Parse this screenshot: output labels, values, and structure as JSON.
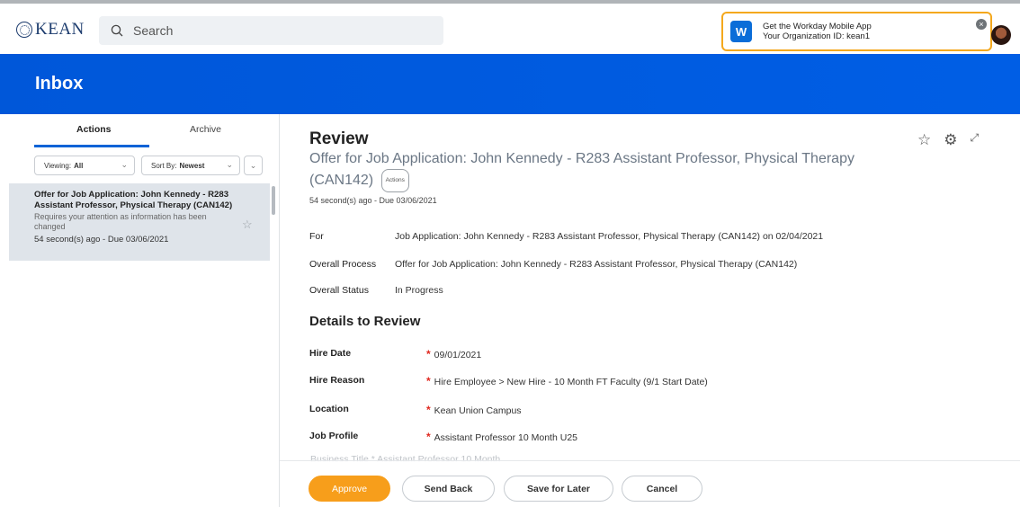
{
  "header": {
    "logo_text": "KEAN",
    "search_placeholder": "Search",
    "promo": {
      "logo_letter": "W",
      "title": "Get the Workday Mobile App",
      "subtitle": "Your Organization ID: kean1"
    }
  },
  "inbox": {
    "title": "Inbox",
    "tabs": [
      {
        "label": "Actions",
        "active": true
      },
      {
        "label": "Archive",
        "active": false
      }
    ],
    "filters": {
      "viewing_label": "Viewing:",
      "viewing_value": "All",
      "sort_label": "Sort By:",
      "sort_value": "Newest"
    },
    "items": [
      {
        "title": "Offer for Job Application: John Kennedy - R283 Assistant Professor, Physical Therapy (CAN142)",
        "description": "Requires your attention as information has been changed",
        "due": "54 second(s) ago - Due 03/06/2021"
      }
    ]
  },
  "review": {
    "title": "Review",
    "subtitle": "Offer for Job Application: John Kennedy - R283 Assistant Professor, Physical Therapy (CAN142)",
    "actions_pill": "Actions",
    "timestamp": "54 second(s) ago - Due 03/06/2021",
    "fields": [
      {
        "label": "For",
        "value": "Job Application: John Kennedy - R283 Assistant Professor, Physical Therapy (CAN142) on 02/04/2021"
      },
      {
        "label": "Overall Process",
        "value": "Offer for Job Application: John Kennedy - R283 Assistant Professor, Physical Therapy (CAN142)"
      },
      {
        "label": "Overall Status",
        "value": "In Progress"
      }
    ],
    "details_title": "Details to Review",
    "details": [
      {
        "label": "Hire Date",
        "value": "09/01/2021"
      },
      {
        "label": "Hire Reason",
        "value": "Hire Employee > New Hire - 10 Month FT Faculty (9/1 Start Date)"
      },
      {
        "label": "Location",
        "value": "Kean Union Campus"
      },
      {
        "label": "Job Profile",
        "value": "Assistant Professor 10 Month U25"
      }
    ],
    "partial_row": "Business Title    *  Assistant Professor 10 Month"
  },
  "buttons": {
    "approve": "Approve",
    "send_back": "Send Back",
    "save_for_later": "Save for Later",
    "cancel": "Cancel"
  },
  "colors": {
    "brand_blue": "#0057d9",
    "approve_orange": "#f79e1b",
    "required_red": "#e0281f",
    "promo_border": "#f4a81d"
  }
}
